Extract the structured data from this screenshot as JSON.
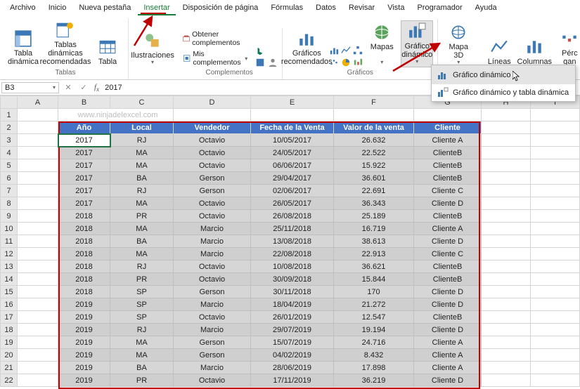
{
  "menubar": [
    "Archivo",
    "Inicio",
    "Nueva pestaña",
    "Insertar",
    "Disposición de página",
    "Fórmulas",
    "Datos",
    "Revisar",
    "Vista",
    "Programador",
    "Ayuda"
  ],
  "menubar_active_index": 3,
  "ribbon": {
    "group_tables": {
      "label": "Tablas",
      "btn_pivot": "Tabla\ndinámica",
      "btn_recpivot": "Tablas dinámicas\nrecomendadas",
      "btn_table": "Tabla"
    },
    "group_illus": {
      "btn": "Ilustraciones"
    },
    "group_addins": {
      "label": "Complementos",
      "get": "Obtener complementos",
      "my": "Mis complementos"
    },
    "group_charts": {
      "label": "Gráficos",
      "rec": "Gráficos\nrecomendados",
      "maps": "Mapas",
      "pivotchart": "Gráfico\ndinámico"
    },
    "group_tours": {
      "btn": "Mapa\n3D"
    },
    "group_spark": {
      "lines": "Líneas",
      "cols": "Columnas",
      "winloss": "Pérc\ngan"
    }
  },
  "dropdown": {
    "item1": "Gráfico dinámico",
    "item2": "Gráfico dinámico y tabla dinámica"
  },
  "namebox": "B3",
  "formula": "2017",
  "watermark": "www.ninjadelexcel.com",
  "columns": [
    "",
    "A",
    "B",
    "C",
    "D",
    "E",
    "F",
    "G",
    "H",
    "I"
  ],
  "headers": [
    "Año",
    "Local",
    "Vendedor",
    "Fecha de la Venta",
    "Valor de la venta",
    "Cliente"
  ],
  "rows": [
    [
      "2017",
      "RJ",
      "Octavio",
      "10/05/2017",
      "26.632",
      "Cliente A"
    ],
    [
      "2017",
      "MA",
      "Octavio",
      "24/05/2017",
      "22.522",
      "ClienteB"
    ],
    [
      "2017",
      "MA",
      "Octavio",
      "06/06/2017",
      "15.922",
      "ClienteB"
    ],
    [
      "2017",
      "BA",
      "Gerson",
      "29/04/2017",
      "36.601",
      "ClienteB"
    ],
    [
      "2017",
      "RJ",
      "Gerson",
      "02/06/2017",
      "22.691",
      "Cliente C"
    ],
    [
      "2017",
      "MA",
      "Octavio",
      "26/05/2017",
      "36.343",
      "Cliente D"
    ],
    [
      "2018",
      "PR",
      "Octavio",
      "26/08/2018",
      "25.189",
      "ClienteB"
    ],
    [
      "2018",
      "MA",
      "Marcio",
      "25/11/2018",
      "16.719",
      "Cliente A"
    ],
    [
      "2018",
      "BA",
      "Marcio",
      "13/08/2018",
      "38.613",
      "Cliente D"
    ],
    [
      "2018",
      "MA",
      "Marcio",
      "22/08/2018",
      "22.913",
      "Cliente C"
    ],
    [
      "2018",
      "RJ",
      "Octavio",
      "10/08/2018",
      "36.621",
      "ClienteB"
    ],
    [
      "2018",
      "PR",
      "Octavio",
      "30/09/2018",
      "15.844",
      "ClienteB"
    ],
    [
      "2018",
      "SP",
      "Gerson",
      "30/11/2018",
      "170",
      "Cliente D"
    ],
    [
      "2019",
      "SP",
      "Marcio",
      "18/04/2019",
      "21.272",
      "Cliente D"
    ],
    [
      "2019",
      "SP",
      "Octavio",
      "26/01/2019",
      "12.547",
      "ClienteB"
    ],
    [
      "2019",
      "RJ",
      "Marcio",
      "29/07/2019",
      "19.194",
      "Cliente D"
    ],
    [
      "2019",
      "MA",
      "Gerson",
      "15/07/2019",
      "24.716",
      "Cliente A"
    ],
    [
      "2019",
      "MA",
      "Gerson",
      "04/02/2019",
      "8.432",
      "Cliente A"
    ],
    [
      "2019",
      "BA",
      "Marcio",
      "28/06/2019",
      "17.898",
      "Cliente A"
    ],
    [
      "2019",
      "PR",
      "Octavio",
      "17/11/2019",
      "36.219",
      "Cliente D"
    ]
  ]
}
